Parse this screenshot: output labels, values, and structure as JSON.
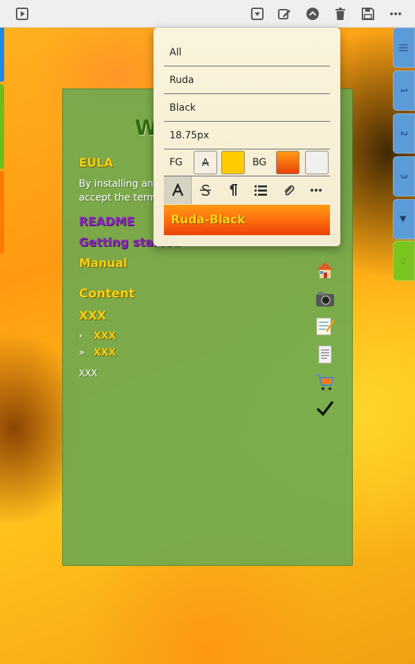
{
  "toolbar": {
    "left_icon": "play-box-icon",
    "right_icons": [
      "dropdown-box-icon",
      "edit-icon",
      "chevron-up-circle-icon",
      "trash-icon",
      "save-icon",
      "more-horizontal-icon"
    ]
  },
  "right_tabs": [
    "|||",
    "1",
    "2",
    "3",
    "▶",
    "▭"
  ],
  "panel": {
    "heading": "W",
    "eula": "EULA",
    "body_line1": "By installing an",
    "body_line2": "accept the term",
    "readme": "README",
    "getting_started": "Getting started",
    "manual": "Manual",
    "content": "Content",
    "xxx_big": "XXX",
    "bullet1_marker": "›",
    "bullet1_text": "XXX",
    "bullet2_marker": "»",
    "bullet2_text": "XXX",
    "xxx_small": "XXX",
    "icons": [
      "house-icon",
      "camera-icon",
      "notepad-icon",
      "note-icon",
      "cart-icon",
      "checkmark-icon"
    ]
  },
  "popup": {
    "scope": "All",
    "font_family": "Ruda",
    "font_weight": "Black",
    "font_size": "18.75px",
    "fg_label": "FG",
    "bg_label": "BG",
    "fg_swatch_glyph": "A",
    "fg_color": "#ffcc00",
    "bg_color": "#f07010",
    "preview_text": "Ruda-Black",
    "tools": [
      "font-icon",
      "strikethrough-icon",
      "pilcrow-icon",
      "list-icon",
      "paperclip-icon",
      "more-horizontal-icon"
    ]
  }
}
